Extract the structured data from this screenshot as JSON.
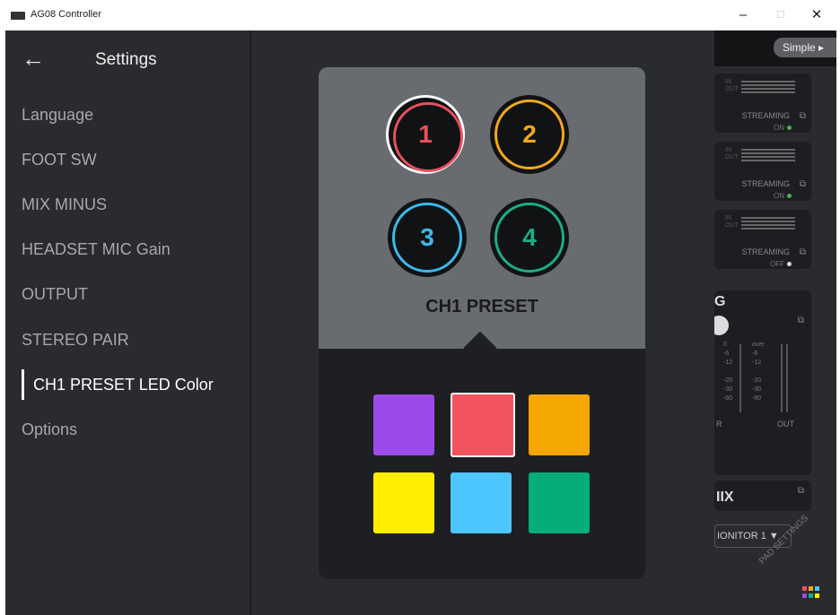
{
  "window": {
    "title": "AG08 Controller",
    "minimize": "–",
    "maximize": "☐",
    "close": "✕"
  },
  "settings": {
    "back_icon": "←",
    "title": "Settings",
    "menu": [
      "Language",
      "FOOT SW",
      "MIX MINUS",
      "HEADSET MIC Gain",
      "OUTPUT",
      "STEREO PAIR",
      "CH1 PRESET LED Color",
      "Options"
    ],
    "active_index": 6
  },
  "preset": {
    "label": "CH1 PRESET",
    "pads": [
      {
        "number": "1",
        "color": "#e8505f",
        "selected": true
      },
      {
        "number": "2",
        "color": "#f2a81c",
        "selected": false
      },
      {
        "number": "3",
        "color": "#3bb9ec",
        "selected": false
      },
      {
        "number": "4",
        "color": "#1aaf82",
        "selected": false
      }
    ],
    "swatches": [
      {
        "color": "#9b4be8",
        "selected": false
      },
      {
        "color": "#f3525f",
        "selected": true
      },
      {
        "color": "#f3a700",
        "selected": false
      },
      {
        "color": "#ffee00",
        "selected": false
      },
      {
        "color": "#4cc6ff",
        "selected": false
      },
      {
        "color": "#06ad78",
        "selected": false
      }
    ]
  },
  "background_app": {
    "mode_button": "Simple ▸",
    "strips": [
      {
        "in": "IN",
        "out": "OUT",
        "label": "STREAMING",
        "state": "ON",
        "dot_color": "#4caf50"
      },
      {
        "in": "IN",
        "out": "OUT",
        "label": "STREAMING",
        "state": "ON",
        "dot_color": "#4caf50"
      },
      {
        "in": "IN",
        "out": "OUT",
        "label": "STREAMING",
        "state": "OFF",
        "dot_color": "#dddddd"
      }
    ],
    "partial_g": "G",
    "meter_scale": [
      "0",
      "-6",
      "-12",
      "",
      "-20",
      "-30",
      "-60"
    ],
    "over": "over",
    "r_label": "R",
    "out_label": "OUT",
    "mix_label": "IIX",
    "monitor": "IONITOR 1 ▼",
    "pad_settings": "PAD SETTINGS",
    "grid_colors": [
      "#e8505f",
      "#f2a81c",
      "#4cc6ff",
      "#9b4be8",
      "#1aaf82",
      "#ffee00"
    ]
  }
}
